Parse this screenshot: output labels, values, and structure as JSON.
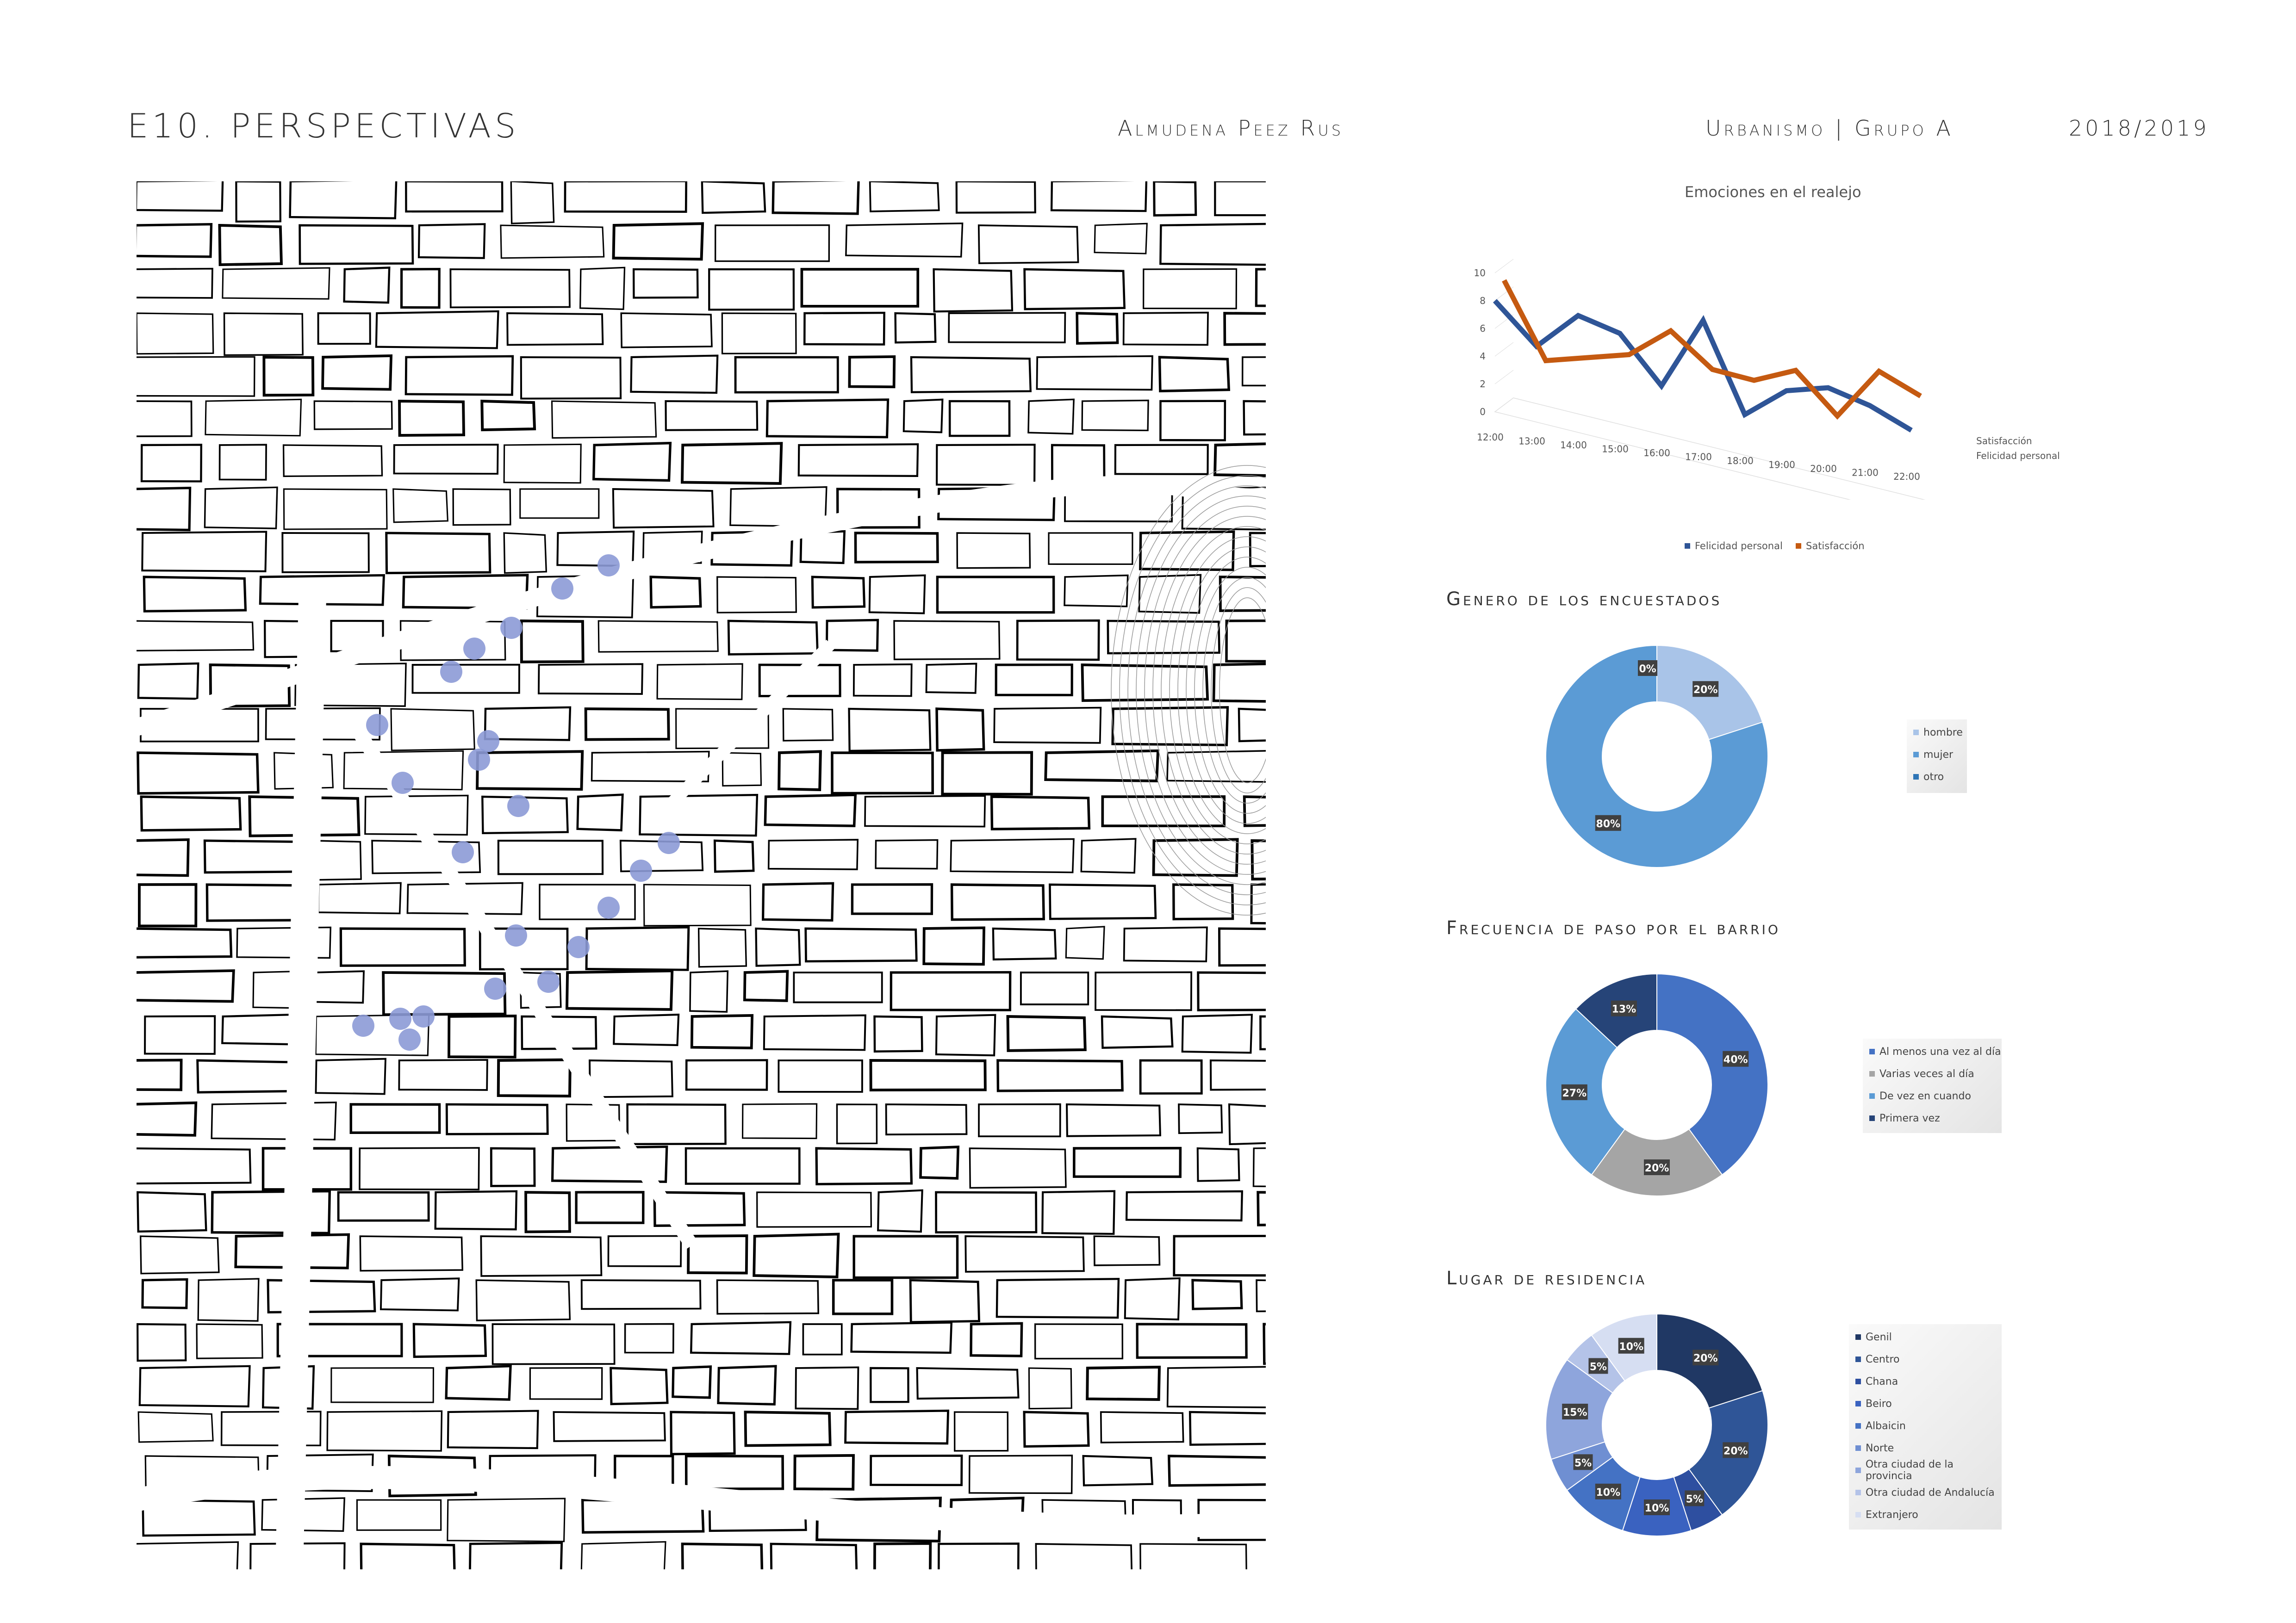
{
  "header": {
    "title": "E10. PERSPECTIVAS",
    "author": "Almudena Peez Rus",
    "course": "Urbanismo | Grupo A",
    "year": "2018/2019"
  },
  "map": {
    "kind": "urban street map",
    "street_color": "#000000",
    "point_color": "#8c9ad6"
  },
  "chart_data": [
    {
      "type": "line",
      "title": "Emociones en el realejo",
      "categories": [
        "12:00",
        "13:00",
        "14:00",
        "15:00",
        "16:00",
        "17:00",
        "18:00",
        "19:00",
        "20:00",
        "21:00",
        "22:00"
      ],
      "series": [
        {
          "name": "Felicidad personal",
          "color": "#2f5597",
          "values": [
            8,
            5,
            7.5,
            6.5,
            3,
            8,
            1.5,
            3.5,
            4,
            3,
            1.5
          ]
        },
        {
          "name": "Satisfacción",
          "color": "#c55a11",
          "values": [
            9,
            3.5,
            4,
            4.5,
            6.5,
            4,
            3.5,
            4.5,
            1.5,
            5,
            3.5
          ]
        }
      ],
      "yticks": [
        "0",
        "2",
        "4",
        "6",
        "8",
        "10"
      ],
      "ylim": [
        0,
        10
      ],
      "depth_labels": [
        "Satisfacción",
        "Felicidad personal"
      ],
      "legend": "bottom"
    },
    {
      "type": "pie",
      "title": "Genero de los encuestados",
      "labels": [
        "hombre",
        "mujer",
        "otro"
      ],
      "values": [
        20,
        80,
        0
      ],
      "value_labels": [
        "20%",
        "80%",
        "0%"
      ],
      "colors": [
        "#a9c4e8",
        "#5b9bd5",
        "#2e75b6"
      ],
      "legend": "right"
    },
    {
      "type": "pie",
      "title": "Frecuencia de paso por el barrio",
      "labels": [
        "Al menos una vez al día",
        "Varias veces al día",
        "De vez en cuando",
        "Primera vez"
      ],
      "values": [
        40,
        20,
        27,
        13
      ],
      "value_labels": [
        "40%",
        "20%",
        "27%",
        "13%"
      ],
      "colors": [
        "#4472c4",
        "#a5a5a5",
        "#5b9bd5",
        "#264478"
      ],
      "legend": "right"
    },
    {
      "type": "pie",
      "title": "Lugar de residencia",
      "labels": [
        "Genil",
        "Centro",
        "Chana",
        "Beiro",
        "Albaicin",
        "Norte",
        "Otra ciudad de la provincia",
        "Otra ciudad de Andalucía",
        "Extranjero"
      ],
      "values": [
        20,
        20,
        5,
        10,
        10,
        5,
        15,
        5,
        10
      ],
      "value_labels": [
        "20%",
        "20%",
        "5%",
        "10%",
        "10%",
        "5%",
        "15%",
        "5%",
        "10%"
      ],
      "colors": [
        "#203864",
        "#2f5597",
        "#2e4fa0",
        "#3a62c0",
        "#4472c4",
        "#6f8fd2",
        "#8ea5dc",
        "#b4c3e8",
        "#d6deF2"
      ],
      "legend": "right"
    }
  ]
}
